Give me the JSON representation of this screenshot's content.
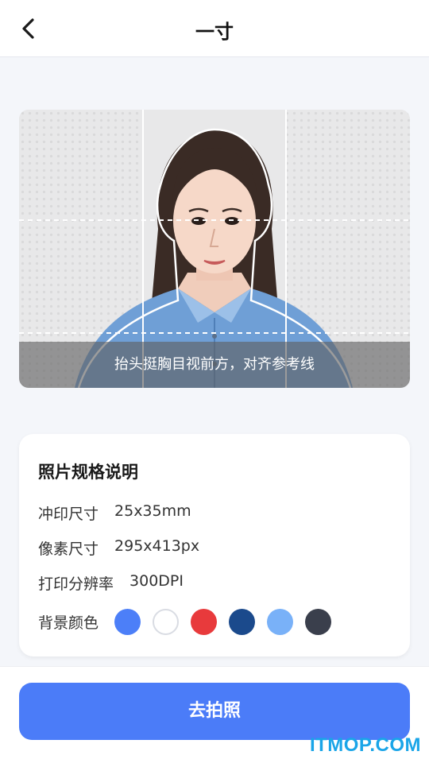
{
  "header": {
    "back_icon": "chevron-left-icon",
    "title": "一寸"
  },
  "preview": {
    "hint": "抬头挺胸目视前方，对齐参考线"
  },
  "spec": {
    "title": "照片规格说明",
    "print_size_label": "冲印尺寸",
    "print_size_value": "25x35mm",
    "pixel_size_label": "像素尺寸",
    "pixel_size_value": "295x413px",
    "dpi_label": "打印分辨率",
    "dpi_value": "300DPI",
    "bg_color_label": "背景颜色",
    "bg_colors": [
      "#4c7ff8",
      "#ffffff",
      "#e83a3c",
      "#1b4a8c",
      "#79b1f8",
      "#3a3f4c"
    ]
  },
  "actions": {
    "shoot_label": "去拍照"
  },
  "watermark": "ITMOP.COM"
}
